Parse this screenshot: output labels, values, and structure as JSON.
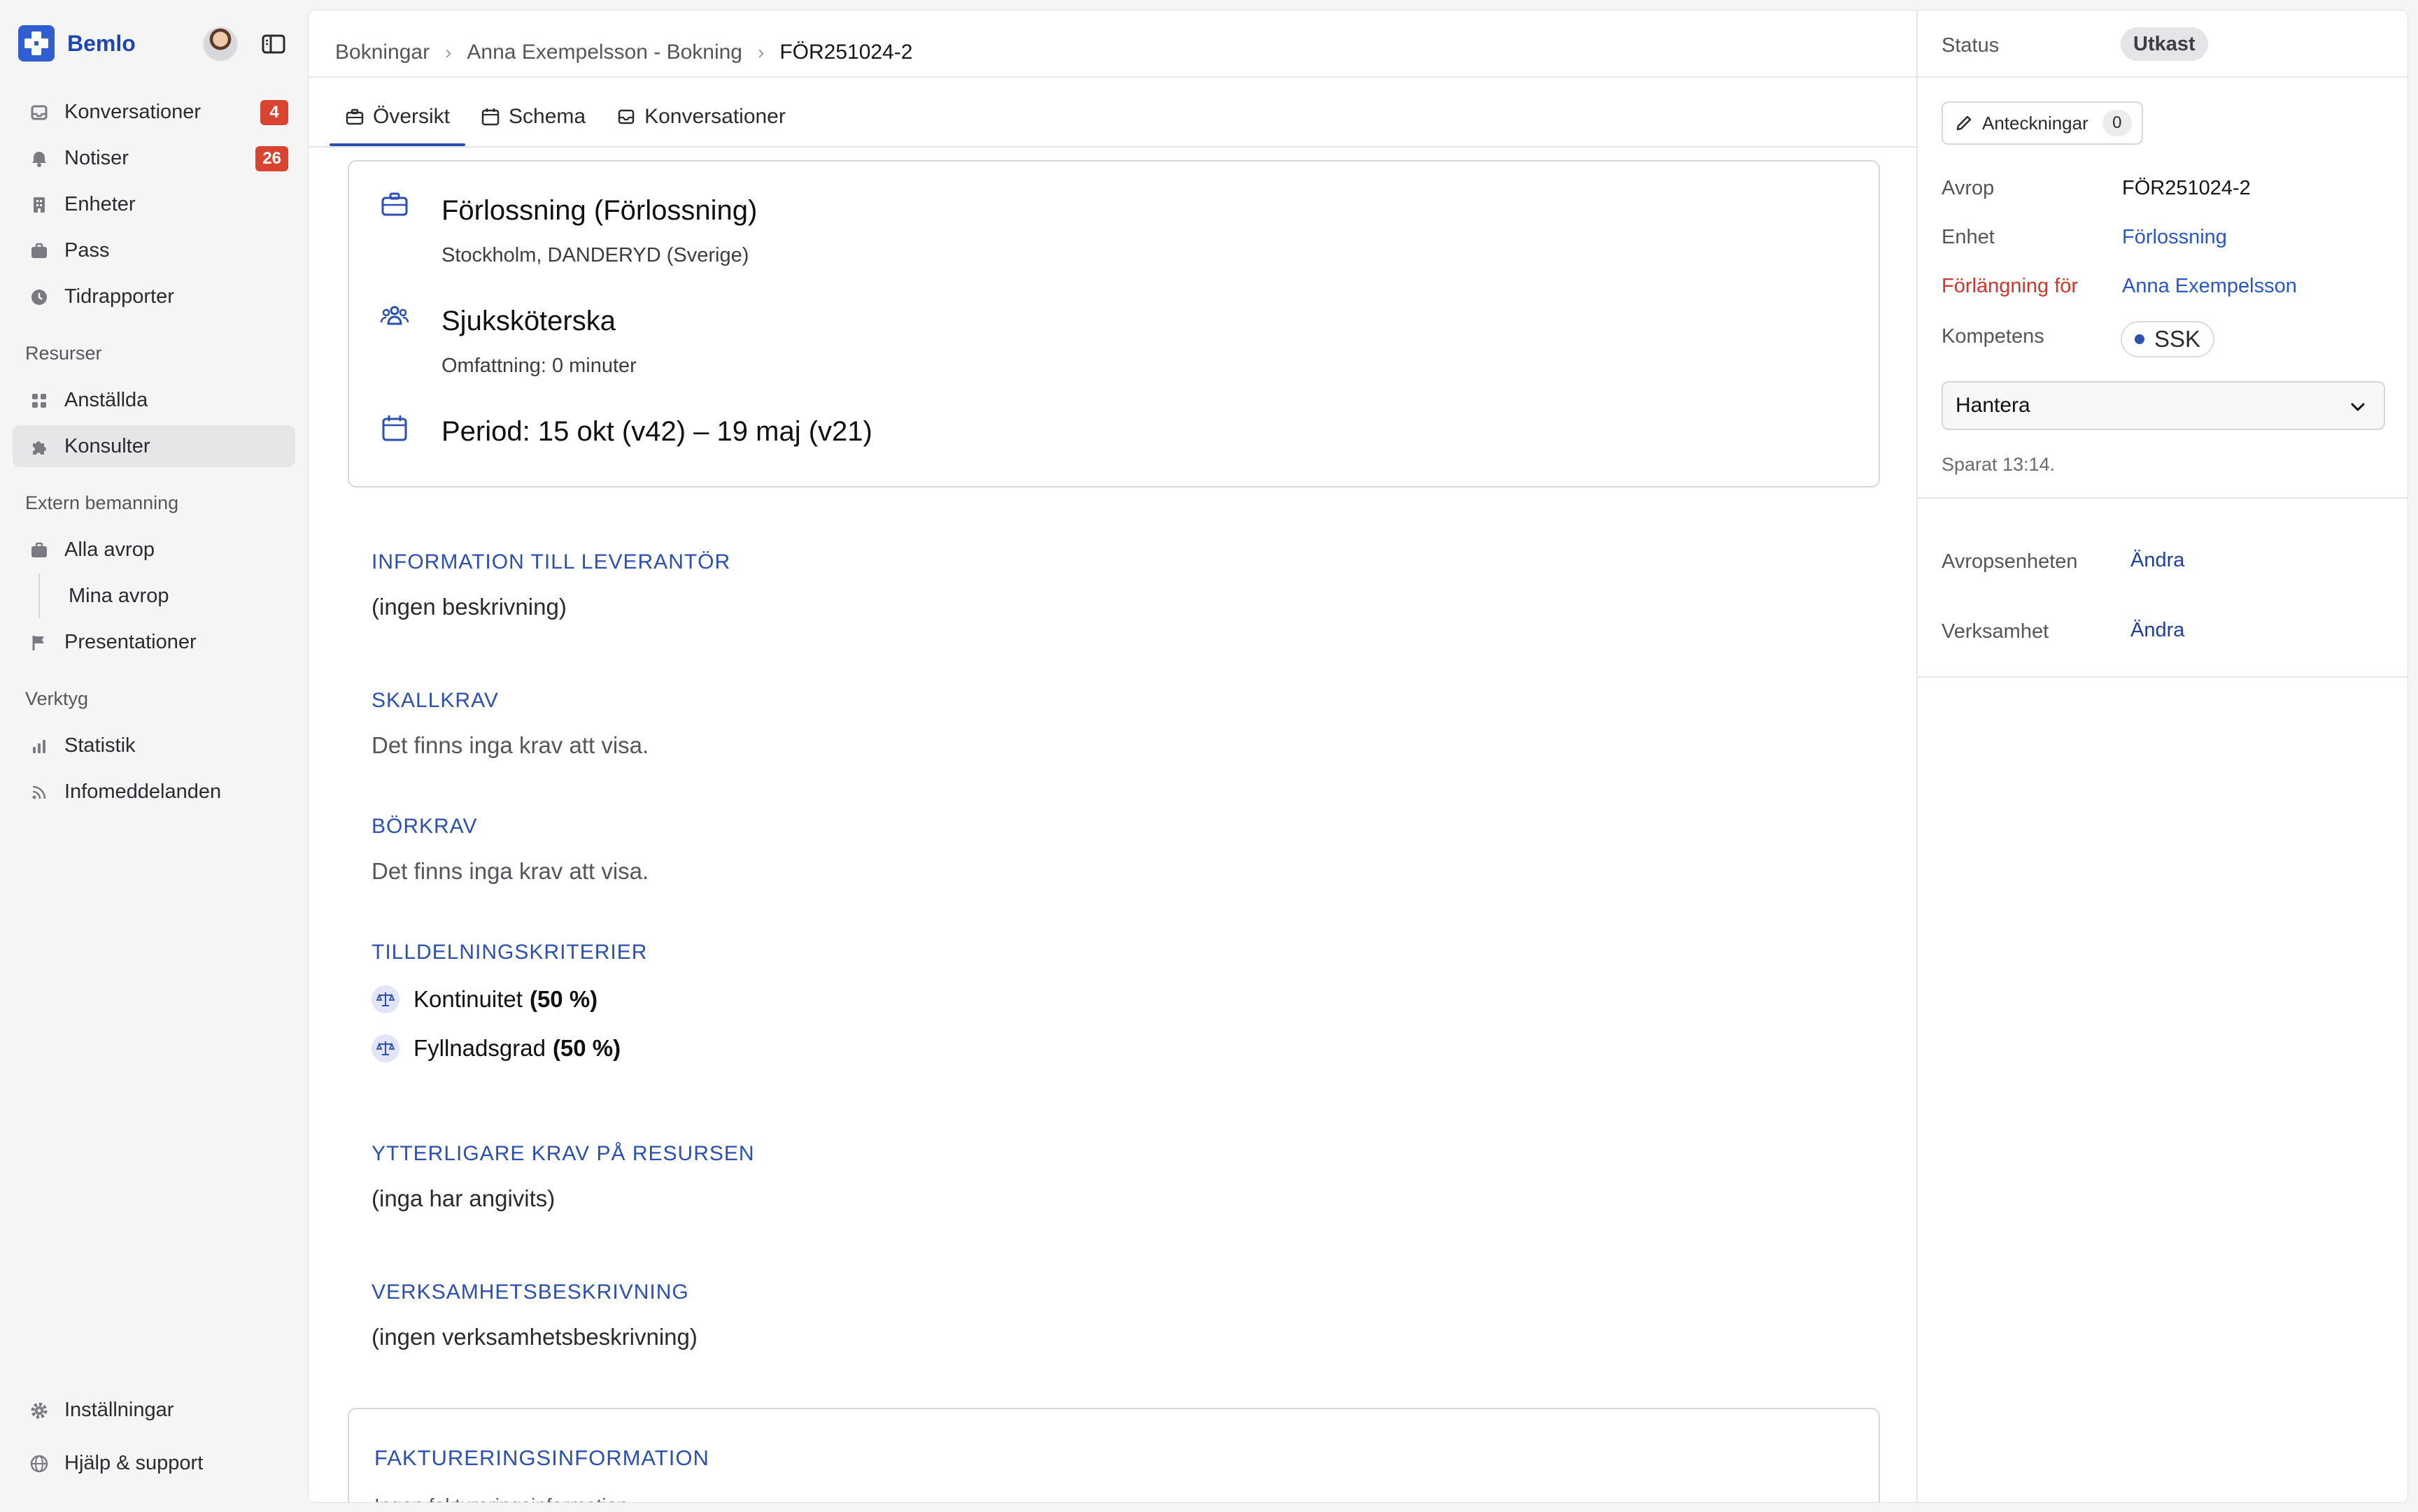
{
  "brand": {
    "name": "Bemlo"
  },
  "sidebar": {
    "items": [
      {
        "label": "Konversationer",
        "badge": "4",
        "icon": "inbox-icon"
      },
      {
        "label": "Notiser",
        "badge": "26",
        "icon": "bell-icon"
      },
      {
        "label": "Enheter",
        "icon": "building-icon"
      },
      {
        "label": "Pass",
        "icon": "briefcase-icon"
      },
      {
        "label": "Tidrapporter",
        "icon": "clock-icon"
      }
    ],
    "resources_title": "Resurser",
    "resources": [
      {
        "label": "Anställda",
        "icon": "grid-icon"
      },
      {
        "label": "Konsulter",
        "icon": "puzzle-icon",
        "active": true
      }
    ],
    "extern_title": "Extern bemanning",
    "extern": [
      {
        "label": "Alla avrop",
        "icon": "briefcase-icon"
      },
      {
        "label": "Mina avrop"
      },
      {
        "label": "Presentationer",
        "icon": "flag-icon"
      }
    ],
    "tools_title": "Verktyg",
    "tools": [
      {
        "label": "Statistik",
        "icon": "bar-chart-icon"
      },
      {
        "label": "Infomeddelanden",
        "icon": "rss-icon"
      }
    ],
    "footer": [
      {
        "label": "Inställningar",
        "icon": "gear-icon"
      },
      {
        "label": "Hjälp & support",
        "icon": "globe-icon"
      }
    ]
  },
  "breadcrumb": [
    "Bokningar",
    "Anna Exempelsson - Bokning",
    "FÖR251024-2"
  ],
  "tabs": [
    "Översikt",
    "Schema",
    "Konversationer"
  ],
  "summary": {
    "unit_title": "Förlossning (Förlossning)",
    "unit_location": "Stockholm, DANDERYD (Sverige)",
    "role_title": "Sjuksköterska",
    "role_scope": "Omfattning: 0 minuter",
    "period": "Period: 15 okt (v42) – 19 maj (v21)"
  },
  "sections": {
    "supplier_info_title": "INFORMATION TILL LEVERANTÖR",
    "supplier_info_text": "(ingen beskrivning)",
    "must_title": "SKALLKRAV",
    "must_text": "Det finns inga krav att visa.",
    "should_title": "BÖRKRAV",
    "should_text": "Det finns inga krav att visa.",
    "criteria_title": "TILLDELNINGSKRITERIER",
    "criteria": [
      {
        "name": "Kontinuitet",
        "weight": "(50 %)"
      },
      {
        "name": "Fyllnadsgrad",
        "weight": "(50 %)"
      }
    ],
    "extra_title": "YTTERLIGARE KRAV PÅ RESURSEN",
    "extra_text": "(inga har angivits)",
    "business_title": "VERKSAMHETSBESKRIVNING",
    "business_text": "(ingen verksamhetsbeskrivning)",
    "billing_title": "FAKTURERINGSINFORMATION",
    "billing_text": "Ingen faktureringsinformation"
  },
  "right": {
    "status_label": "Status",
    "status_value": "Utkast",
    "notes_label": "Anteckningar",
    "notes_count": "0",
    "avrop_label": "Avrop",
    "avrop_value": "FÖR251024-2",
    "enhet_label": "Enhet",
    "enhet_value": "Förlossning",
    "extension_label": "Förlängning för",
    "extension_value": "Anna Exempelsson",
    "competence_label": "Kompetens",
    "competence_value": "SSK",
    "manage_label": "Hantera",
    "saved_text": "Sparat 13:14.",
    "avropsenhet_label": "Avropsenheten",
    "verksamhet_label": "Verksamhet",
    "edit_label": "Ändra"
  },
  "colors": {
    "accent": "#2b4fb3",
    "badge": "#d9432f",
    "warning_label": "#d1352b"
  }
}
